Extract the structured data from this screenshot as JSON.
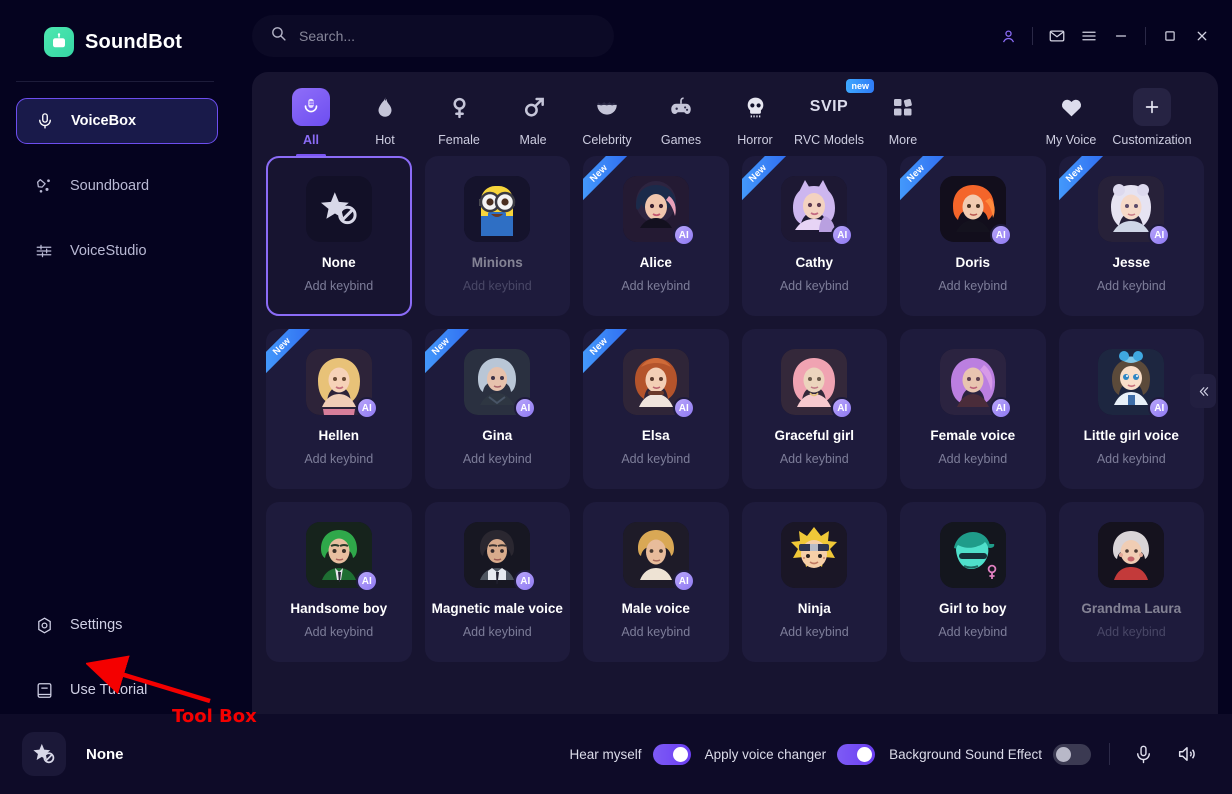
{
  "app": {
    "brand": "SoundBot",
    "logo_icon": "robot-icon"
  },
  "sidebar": {
    "items": [
      {
        "label": "VoiceBox",
        "icon": "microphone-icon",
        "active": true
      },
      {
        "label": "Soundboard",
        "icon": "sparkle-star-icon",
        "active": false
      },
      {
        "label": "VoiceStudio",
        "icon": "sliders-icon",
        "active": false
      }
    ],
    "bottom_items": [
      {
        "label": "Settings",
        "icon": "gear-icon"
      },
      {
        "label": "Use Tutorial",
        "icon": "book-icon"
      }
    ],
    "tools": [
      {
        "name": "toolbox-icon",
        "has_badge": true
      },
      {
        "name": "chat-bubble-icon",
        "has_badge": false
      }
    ]
  },
  "annotation": {
    "label": "Tool Box",
    "color": "#f40000",
    "target": "toolbox-icon"
  },
  "search": {
    "placeholder": "Search...",
    "value": "",
    "icon": "search-icon"
  },
  "window_controls": [
    {
      "name": "account-icon",
      "glyph": "person",
      "accent": true
    },
    {
      "name": "mail-icon",
      "glyph": "envelope",
      "accent": false
    },
    {
      "name": "menu-icon",
      "glyph": "hamburger",
      "accent": false
    },
    {
      "name": "minimize-button",
      "glyph": "minus",
      "accent": false
    },
    {
      "name": "maximize-button",
      "glyph": "square",
      "accent": false
    },
    {
      "name": "close-button",
      "glyph": "cross",
      "accent": false
    }
  ],
  "categories": [
    {
      "label": "All",
      "icon": "mic-voice-icon",
      "active": true,
      "badge": ""
    },
    {
      "label": "Hot",
      "icon": "flame-icon",
      "active": false,
      "badge": ""
    },
    {
      "label": "Female",
      "icon": "venus-icon",
      "active": false,
      "badge": ""
    },
    {
      "label": "Male",
      "icon": "mars-icon",
      "active": false,
      "badge": ""
    },
    {
      "label": "Celebrity",
      "icon": "sunglasses-icon",
      "active": false,
      "badge": ""
    },
    {
      "label": "Games",
      "icon": "gamepad-icon",
      "active": false,
      "badge": ""
    },
    {
      "label": "Horror",
      "icon": "skull-icon",
      "active": false,
      "badge": ""
    },
    {
      "label": "RVC Models",
      "icon": "svip-icon",
      "active": false,
      "badge": "new"
    },
    {
      "label": "More",
      "icon": "grid-squares-icon",
      "active": false,
      "badge": ""
    }
  ],
  "category_right": [
    {
      "label": "My Voice",
      "icon": "heart-icon"
    },
    {
      "label": "Customization",
      "icon": "plus-icon"
    }
  ],
  "voices": [
    {
      "name": "None",
      "keybind": "Add keybind",
      "new": false,
      "ai": false,
      "selected": true,
      "dim": false,
      "thumb": "star-slash-icon",
      "emoji": ""
    },
    {
      "name": "Minions",
      "keybind": "Add keybind",
      "new": false,
      "ai": false,
      "selected": false,
      "dim": true,
      "thumb": "minion-avatar",
      "emoji": "🥽"
    },
    {
      "name": "Alice",
      "keybind": "Add keybind",
      "new": true,
      "ai": true,
      "selected": false,
      "dim": false,
      "thumb": "alice-avatar",
      "emoji": ""
    },
    {
      "name": "Cathy",
      "keybind": "Add keybind",
      "new": true,
      "ai": true,
      "selected": false,
      "dim": false,
      "thumb": "cathy-avatar",
      "emoji": ""
    },
    {
      "name": "Doris",
      "keybind": "Add keybind",
      "new": true,
      "ai": true,
      "selected": false,
      "dim": false,
      "thumb": "doris-avatar",
      "emoji": ""
    },
    {
      "name": "Jesse",
      "keybind": "Add keybind",
      "new": true,
      "ai": true,
      "selected": false,
      "dim": false,
      "thumb": "jesse-avatar",
      "emoji": ""
    },
    {
      "name": "Hellen",
      "keybind": "Add keybind",
      "new": true,
      "ai": true,
      "selected": false,
      "dim": false,
      "thumb": "hellen-avatar",
      "emoji": ""
    },
    {
      "name": "Gina",
      "keybind": "Add keybind",
      "new": true,
      "ai": true,
      "selected": false,
      "dim": false,
      "thumb": "gina-avatar",
      "emoji": ""
    },
    {
      "name": "Elsa",
      "keybind": "Add keybind",
      "new": true,
      "ai": true,
      "selected": false,
      "dim": false,
      "thumb": "elsa-avatar",
      "emoji": ""
    },
    {
      "name": "Graceful girl",
      "keybind": "Add keybind",
      "new": false,
      "ai": true,
      "selected": false,
      "dim": false,
      "thumb": "graceful-girl-avatar",
      "emoji": ""
    },
    {
      "name": "Female voice",
      "keybind": "Add keybind",
      "new": false,
      "ai": true,
      "selected": false,
      "dim": false,
      "thumb": "female-voice-avatar",
      "emoji": ""
    },
    {
      "name": "Little girl voice",
      "keybind": "Add keybind",
      "new": false,
      "ai": true,
      "selected": false,
      "dim": false,
      "thumb": "little-girl-avatar",
      "emoji": ""
    },
    {
      "name": "Handsome boy",
      "keybind": "Add keybind",
      "new": false,
      "ai": true,
      "selected": false,
      "dim": false,
      "thumb": "handsome-boy-avatar",
      "emoji": ""
    },
    {
      "name": "Magnetic male voice",
      "keybind": "Add keybind",
      "new": false,
      "ai": true,
      "selected": false,
      "dim": false,
      "thumb": "magnetic-male-avatar",
      "emoji": ""
    },
    {
      "name": "Male voice",
      "keybind": "Add keybind",
      "new": false,
      "ai": true,
      "selected": false,
      "dim": false,
      "thumb": "male-voice-avatar",
      "emoji": ""
    },
    {
      "name": "Ninja",
      "keybind": "Add keybind",
      "new": false,
      "ai": false,
      "selected": false,
      "dim": false,
      "thumb": "ninja-avatar",
      "emoji": ""
    },
    {
      "name": "Girl to boy",
      "keybind": "Add keybind",
      "new": false,
      "ai": false,
      "selected": false,
      "dim": false,
      "thumb": "girl-to-boy-avatar",
      "emoji": ""
    },
    {
      "name": "Grandma Laura",
      "keybind": "Add keybind",
      "new": false,
      "ai": false,
      "selected": false,
      "dim": true,
      "thumb": "grandma-avatar",
      "emoji": "👵"
    }
  ],
  "grid_extras": {
    "collapse_icon": "chevron-double-left-icon",
    "random_icon": "dice-icon"
  },
  "player": {
    "current_voice": "None",
    "thumb_icon": "star-slash-icon"
  },
  "bottom_controls": {
    "toggles": [
      {
        "label": "Hear myself",
        "on": true
      },
      {
        "label": "Apply voice changer",
        "on": true
      },
      {
        "label": "Background Sound Effect",
        "on": false
      }
    ],
    "icons": [
      {
        "name": "microphone-icon"
      },
      {
        "name": "speaker-icon"
      }
    ]
  },
  "colors": {
    "accent": "#7a55f3",
    "brand": "#3ddba0",
    "new_badge": "#2f7cf6",
    "annotation": "#f40000",
    "panel_bg": "#171430",
    "sidebar_bg": "#05031f"
  }
}
